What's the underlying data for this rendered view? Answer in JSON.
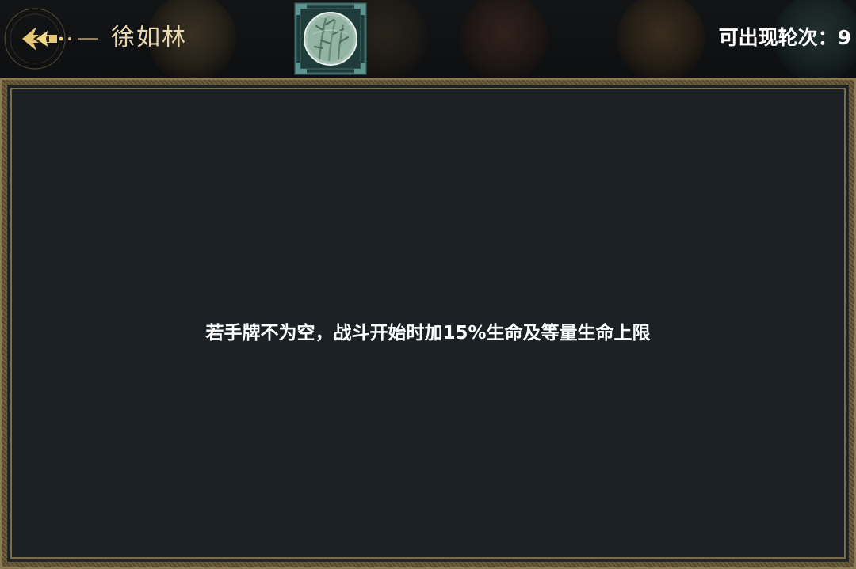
{
  "header": {
    "character_name": "徐如林",
    "rounds_label": "可出现轮次：",
    "rounds_value": "9"
  },
  "selected_item": {
    "icon": "bamboo-medallion-icon"
  },
  "other_items": [
    {
      "icon": "amber-medallion-icon"
    },
    {
      "icon": "figure-medallion-icon"
    },
    {
      "icon": "gold-medallion-icon"
    },
    {
      "icon": "teal-medallion-icon"
    }
  ],
  "panel": {
    "description": "若手牌不为空，战斗开始时加15%生命及等量生命上限"
  },
  "colors": {
    "name_gold": "#e9d7ae",
    "frame_gold": "#8c7a54",
    "panel_bg": "#1b2124",
    "selected_frame_teal": "#3f6f6c"
  }
}
